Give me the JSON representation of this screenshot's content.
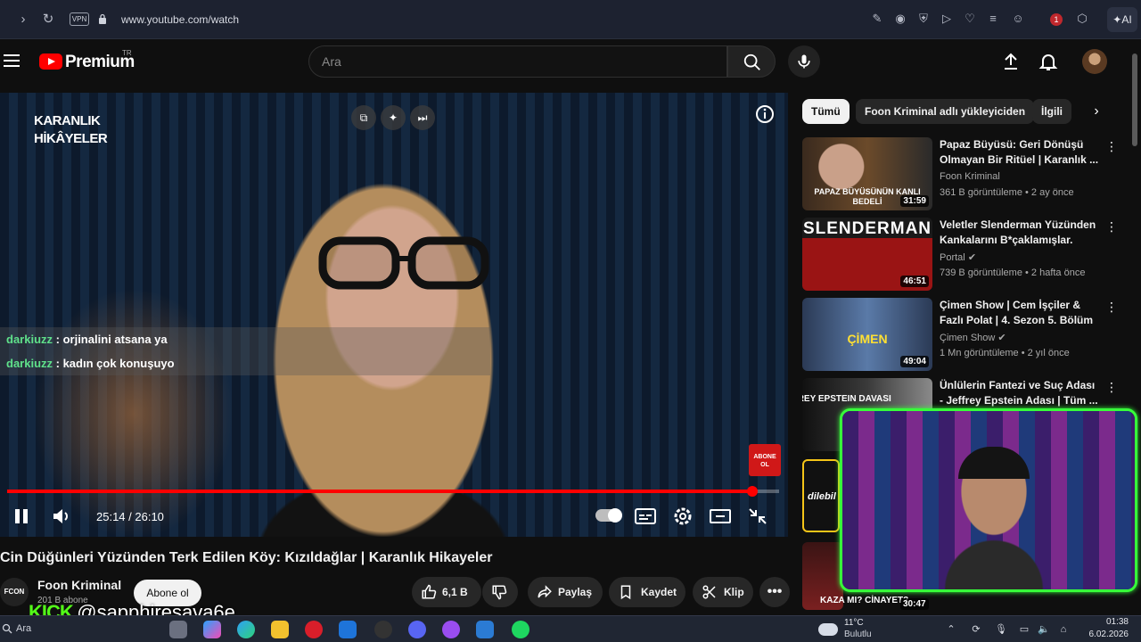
{
  "browser": {
    "url": "www.youtube.com/watch",
    "vpn_label": "VPN",
    "ai_label": "AI",
    "extension_badge": "1"
  },
  "header": {
    "brand": "Premium",
    "region": "TR",
    "search_placeholder": "Ara"
  },
  "player": {
    "watermark": "KARANLIK HİKÂYELER",
    "time_display": "25:14 / 26:10",
    "progress_fraction": 0.965,
    "chat": [
      {
        "user": "darkiuzz",
        "message": ": orjinalini atsana ya"
      },
      {
        "user": "darkiuzz",
        "message": ": kadın çok konuşuyo"
      }
    ],
    "subscribe_badge": "ABONE OL"
  },
  "video": {
    "title": "Cin Düğünleri Yüzünden Terk Edilen Köy: Kızıldağlar | Karanlık Hikayeler",
    "channel_avatar_text": "FCON",
    "channel_name": "Foon Kriminal",
    "channel_subs": "201 B abone",
    "subscribe_label": "Abone ol",
    "likes": "6,1 B",
    "share_label": "Paylaş",
    "save_label": "Kaydet",
    "clip_label": "Klip"
  },
  "overlay": {
    "kick_logo": "KICK",
    "kick_user": "@sapphiresava6e"
  },
  "sidebar": {
    "chips": [
      "Tümü",
      "Foon Kriminal adlı yükleyiciden",
      "İlgili"
    ],
    "recommendations": [
      {
        "title": "Papaz Büyüsü: Geri Dönüşü Olmayan Bir Ritüel | Karanlık ...",
        "channel": "Foon Kriminal",
        "meta": "361 B görüntüleme • 2 ay önce",
        "duration": "31:59",
        "thumb_text": "PAPAZ BÜYÜSÜNÜN KANLI BEDELİ"
      },
      {
        "title": "Veletler Slenderman Yüzünden Kankalarını B*çaklamışlar.",
        "channel": "Portal",
        "meta": "739 B görüntüleme • 2 hafta önce",
        "duration": "46:51",
        "thumb_text": "SLENDERMAN"
      },
      {
        "title": "Çimen Show | Cem İşçiler & Fazlı Polat | 4. Sezon 5. Bölüm",
        "channel": "Çimen Show",
        "meta": "1 Mn görüntüleme • 2 yıl önce",
        "duration": "49:04",
        "thumb_text": "ÇİMEN"
      },
      {
        "title": "Ünlülerin Fantezi ve Suç Adası - Jeffrey Epstein Adası | Tüm ...",
        "channel": "",
        "meta": "",
        "duration": "",
        "thumb_text": "JEFFREY EPSTEIN DAVASI"
      }
    ],
    "partial_thumb_text": "dilebil",
    "partial_thumb_b_text": "KAZA MI? CİNAYET?",
    "webcam_duration": "30:47"
  },
  "taskbar": {
    "search_label": "Ara",
    "temperature": "11°C",
    "condition": "Bulutlu",
    "time": "01:38",
    "date": "6.02.2026"
  },
  "colors": {
    "youtube_red": "#ff0000",
    "kick_green": "#53fc18",
    "chat_user": "#5fe08a"
  }
}
